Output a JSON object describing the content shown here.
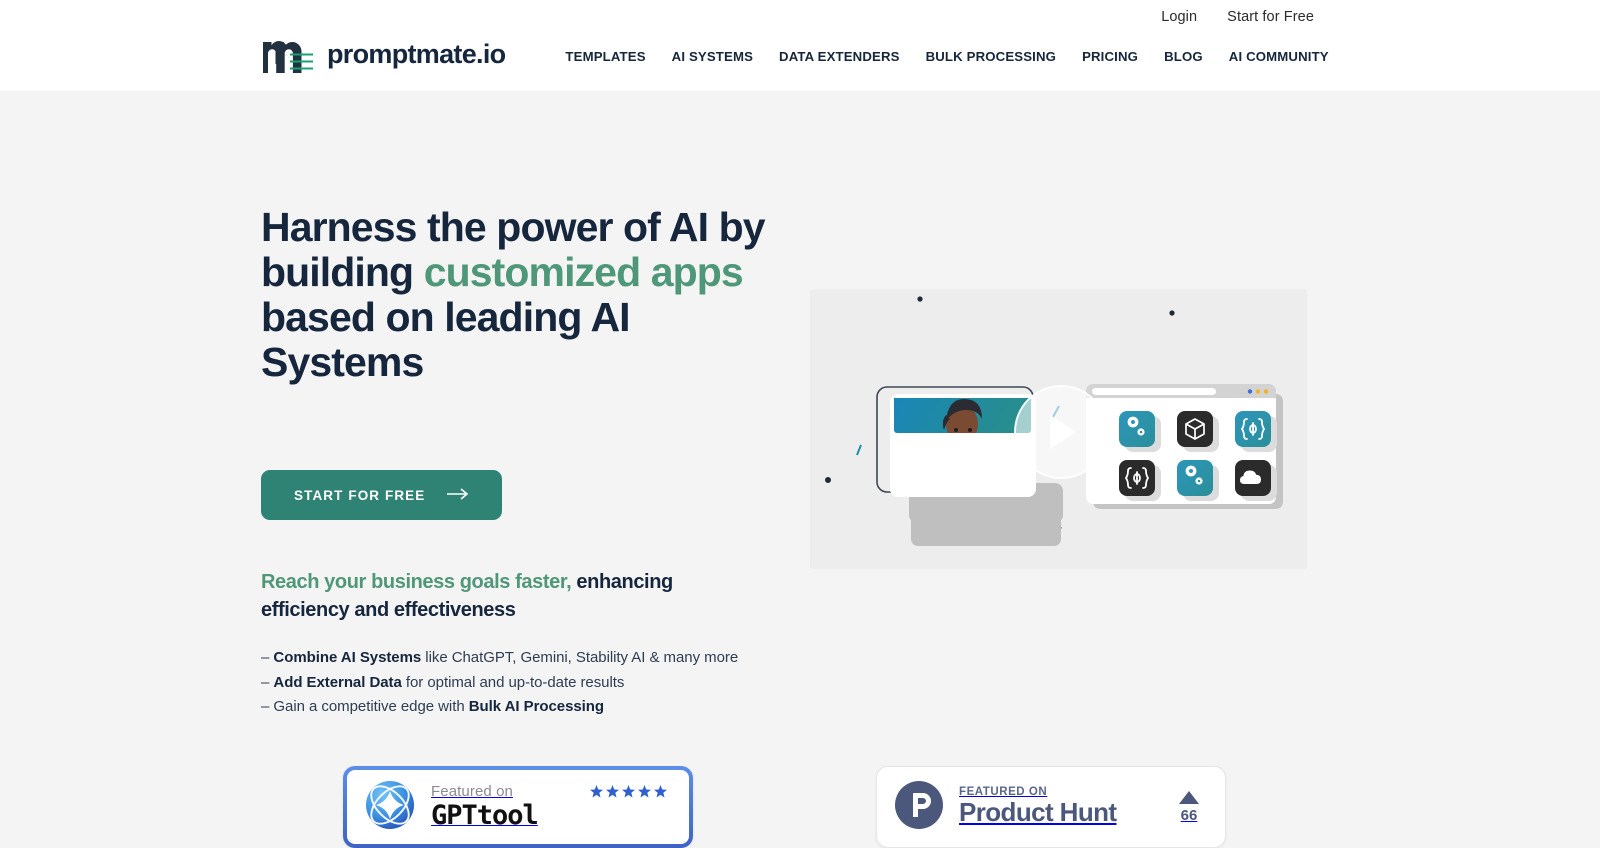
{
  "header": {
    "logo": {
      "text": "promptmate.io",
      "icon": "promptmate-m-logo"
    },
    "topbar": [
      {
        "label": "Login",
        "name": "login-link"
      },
      {
        "label": "Start for Free",
        "name": "start-for-free-link"
      }
    ],
    "nav": [
      {
        "label": "TEMPLATES",
        "name": "nav-templates"
      },
      {
        "label": "AI SYSTEMS",
        "name": "nav-ai-systems"
      },
      {
        "label": "DATA EXTENDERS",
        "name": "nav-data-extenders"
      },
      {
        "label": "BULK PROCESSING",
        "name": "nav-bulk-processing"
      },
      {
        "label": "PRICING",
        "name": "nav-pricing"
      },
      {
        "label": "BLOG",
        "name": "nav-blog"
      },
      {
        "label": "AI COMMUNITY",
        "name": "nav-ai-community"
      }
    ]
  },
  "hero": {
    "headline": {
      "line1": "Harness the power of AI by",
      "line2_pre": "building ",
      "line2_accent": "customized apps",
      "line3": "based on leading AI Systems"
    },
    "cta": {
      "label": "START FOR FREE",
      "icon": "arrow-right-icon"
    },
    "subheading": {
      "accent": "Reach your business goals faster,",
      "rest": " enhancing efficiency and effectiveness"
    },
    "bullets": [
      {
        "dash": "–",
        "bold": "Combine AI Systems",
        "text": " like ChatGPT, Gemini, Stability AI & many more",
        "bold_first": true
      },
      {
        "dash": "–",
        "bold": "Add External Data",
        "text": " for optimal and up-to-date results",
        "bold_first": true
      },
      {
        "dash": "–",
        "pre": "Gain a competitive edge with ",
        "bold": "Bulk AI Processing",
        "bold_first": false
      }
    ],
    "video": {
      "play_label": "play-video",
      "app_icons": [
        "gears-icon",
        "box-icon",
        "code-brackets-icon",
        "code-brackets-icon",
        "gears-icon",
        "cloud-icon"
      ]
    }
  },
  "badges": {
    "gpttool": {
      "featured_label": "Featured on",
      "name": "GPTtool",
      "stars": 5,
      "star_color": "#2f5fd0"
    },
    "producthunt": {
      "featured_label": "FEATURED ON",
      "name": "Product Hunt",
      "upvotes": "66",
      "logo_letter": "P"
    }
  },
  "colors": {
    "brand_navy": "#15263d",
    "brand_green": "#2f8374",
    "accent_green": "#4f9779",
    "page_bg": "#f4f4f4"
  }
}
